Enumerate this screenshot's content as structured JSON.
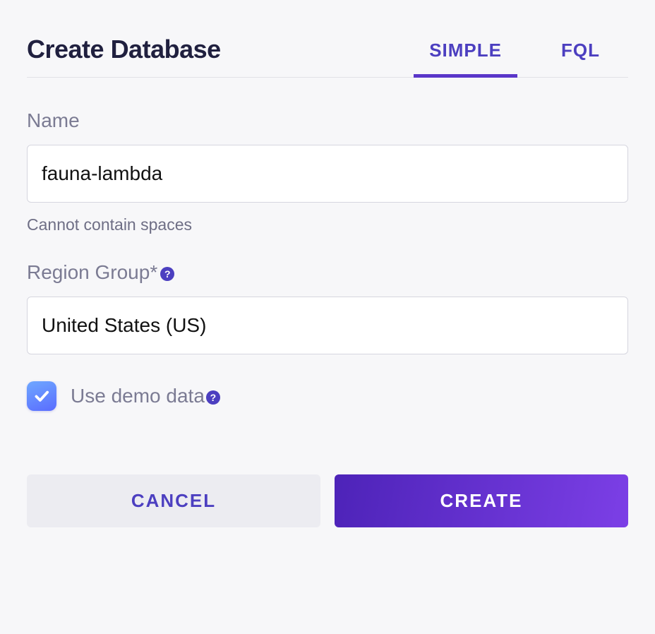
{
  "header": {
    "title": "Create Database",
    "tabs": {
      "simple": "SIMPLE",
      "fql": "FQL"
    }
  },
  "form": {
    "name": {
      "label": "Name",
      "value": "fauna-lambda",
      "hint": "Cannot contain spaces"
    },
    "region": {
      "label": "Region Group*",
      "value": "United States (US)"
    },
    "demo": {
      "label": "Use demo data",
      "checked": true
    }
  },
  "buttons": {
    "cancel": "CANCEL",
    "create": "CREATE"
  }
}
